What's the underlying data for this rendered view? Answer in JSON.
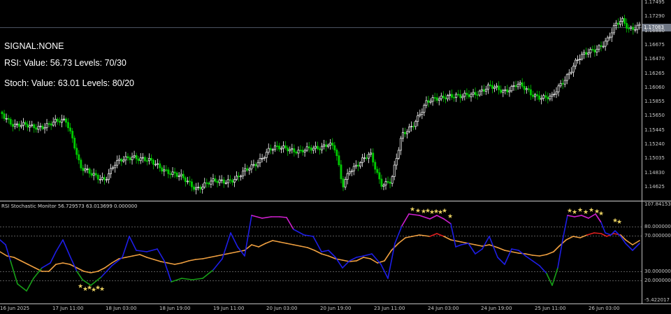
{
  "signal": {
    "text": "SIGNAL:NONE"
  },
  "rsi": {
    "text": "RSI:  Value: 56.73  Levels: 70/30"
  },
  "stoch": {
    "text": "Stoch:  Value: 63.01  Levels: 80/20"
  },
  "indicator": {
    "title": "RSI Stochastic Monitor 56.729573 63.013699 0.000000"
  },
  "price_axis": {
    "labels": [
      "1.17495",
      "1.17290",
      "1.16880",
      "1.16675",
      "1.16470",
      "1.16265",
      "1.16060",
      "1.15855",
      "1.15650",
      "1.15445",
      "1.15240",
      "1.15035",
      "1.14830",
      "1.14625"
    ],
    "current": "1.17083"
  },
  "sub_axis": {
    "labels": [
      "107.841539",
      "80.000000",
      "70.000000",
      "30.000000",
      "20.000000",
      "-5.422017"
    ]
  },
  "time_axis": {
    "labels": [
      "16 Jun 2025",
      "17 Jun 11:00",
      "18 Jun 03:00",
      "18 Jun 19:00",
      "19 Jun 11:00",
      "20 Jun 03:00",
      "20 Jun 19:00",
      "23 Jun 11:00",
      "24 Jun 03:00",
      "24 Jun 19:00",
      "25 Jun 11:00",
      "26 Jun 03:00"
    ]
  },
  "colors": {
    "background": "#000000",
    "bull_candle": "#ffffff",
    "bear_candle": "#00c800",
    "rsi_line": "#f0a040",
    "stoch_line": "#1e1ee6",
    "stoch_overbought": "#d020d0",
    "stoch_oversold": "#18a018",
    "rsi_overbought": "#e02020",
    "star": "#e8d060",
    "level_line": "#b0b0b0"
  }
}
